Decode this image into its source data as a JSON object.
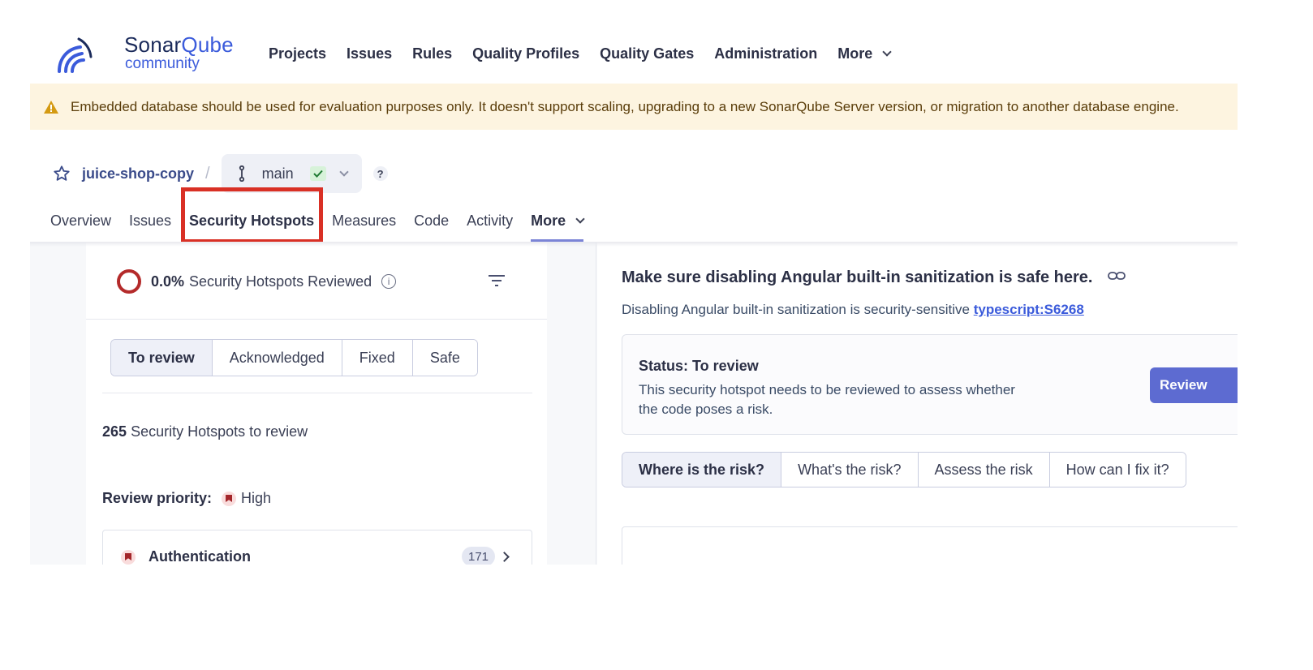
{
  "app": {
    "logo_title_a": "Sonar",
    "logo_title_b": "Qube",
    "logo_sub": "community"
  },
  "nav": {
    "items": [
      "Projects",
      "Issues",
      "Rules",
      "Quality Profiles",
      "Quality Gates",
      "Administration"
    ],
    "more_label": "More"
  },
  "banner": {
    "icon": "warning-icon",
    "text": "Embedded database should be used for evaluation purposes only. It doesn't support scaling, upgrading to a new SonarQube Server version, or migration to another database engine."
  },
  "breadcrumb": {
    "project": "juice-shop-copy",
    "separator": "/",
    "branch": "main",
    "help": "?"
  },
  "project_tabs": {
    "items": [
      "Overview",
      "Issues",
      "Security Hotspots",
      "Measures",
      "Code",
      "Activity"
    ],
    "more_label": "More",
    "active": "Security Hotspots"
  },
  "left_panel": {
    "reviewed_pct": "0.0%",
    "reviewed_label": "Security Hotspots Reviewed",
    "status_filters": [
      "To review",
      "Acknowledged",
      "Fixed",
      "Safe"
    ],
    "active_filter": "To review",
    "count": "265",
    "count_label": "Security Hotspots to review",
    "priority_label": "Review priority:",
    "priority_value": "High",
    "category": {
      "name": "Authentication",
      "count": "171"
    }
  },
  "right_panel": {
    "title": "Make sure disabling Angular built-in sanitization is safe here.",
    "subtitle": "Disabling Angular built-in sanitization is security-sensitive",
    "rule": "typescript:S6268",
    "status_title": "Status: To review",
    "status_desc": "This security hotspot needs to be reviewed to assess whether the code poses a risk.",
    "review_button": "Review",
    "risk_tabs": [
      "Where is the risk?",
      "What's the risk?",
      "Assess the risk",
      "How can I fix it?"
    ],
    "active_risk_tab": "Where is the risk?"
  },
  "colors": {
    "accent": "#5d6bd1",
    "highlight": "#d93025",
    "banner_bg": "#fdf4e0",
    "high_priority": "#a3262a"
  }
}
